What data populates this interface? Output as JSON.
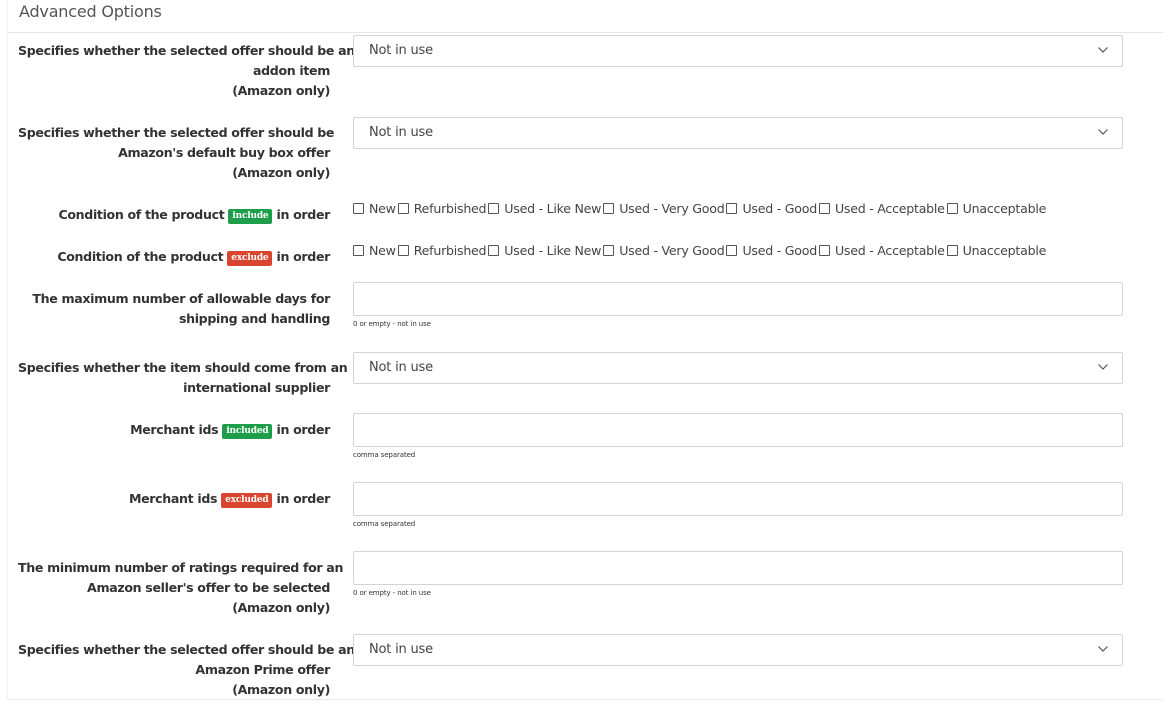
{
  "panel": {
    "title": "Advanced Options"
  },
  "rows": {
    "addon": {
      "lines": [
        "Specifies whether the selected offer should be an",
        "addon item",
        "(Amazon only)"
      ],
      "value": "Not in use"
    },
    "buybox": {
      "lines": [
        "Specifies whether the selected offer should be",
        "Amazon's default buy box offer",
        "(Amazon only)"
      ],
      "value": "Not in use"
    },
    "cond_include": {
      "prefix": "Condition of the product",
      "badge": "include",
      "suffix": "in order"
    },
    "cond_exclude": {
      "prefix": "Condition of the product",
      "badge": "exclude",
      "suffix": "in order"
    },
    "shipping_days": {
      "lines": [
        "The maximum number of allowable days for",
        "shipping and handling"
      ],
      "value": "",
      "help": "0 or empty - not in use"
    },
    "international": {
      "lines": [
        "Specifies whether the item should come from an",
        "international supplier"
      ],
      "value": "Not in use"
    },
    "merchant_included": {
      "prefix": "Merchant ids",
      "badge": "included",
      "suffix": "in order",
      "value": "",
      "help": "comma separated"
    },
    "merchant_excluded": {
      "prefix": "Merchant ids",
      "badge": "excluded",
      "suffix": "in order",
      "value": "",
      "help": "comma separated"
    },
    "min_ratings": {
      "lines": [
        "The minimum number of ratings required for an",
        "Amazon seller's offer to be selected",
        "(Amazon only)"
      ],
      "value": "",
      "help": "0 or empty - not in use"
    },
    "prime": {
      "lines": [
        "Specifies whether the selected offer should be an",
        "Amazon Prime offer",
        "(Amazon only)"
      ],
      "value": "Not in use"
    }
  },
  "conditions": [
    "New",
    "Refurbished",
    "Used - Like New",
    "Used - Very Good",
    "Used - Good",
    "Used - Acceptable",
    "Unacceptable"
  ],
  "colors": {
    "include": "#1e9e4a",
    "exclude": "#d9452f"
  },
  "icons": {
    "dropdown": "chevron-down-icon"
  }
}
